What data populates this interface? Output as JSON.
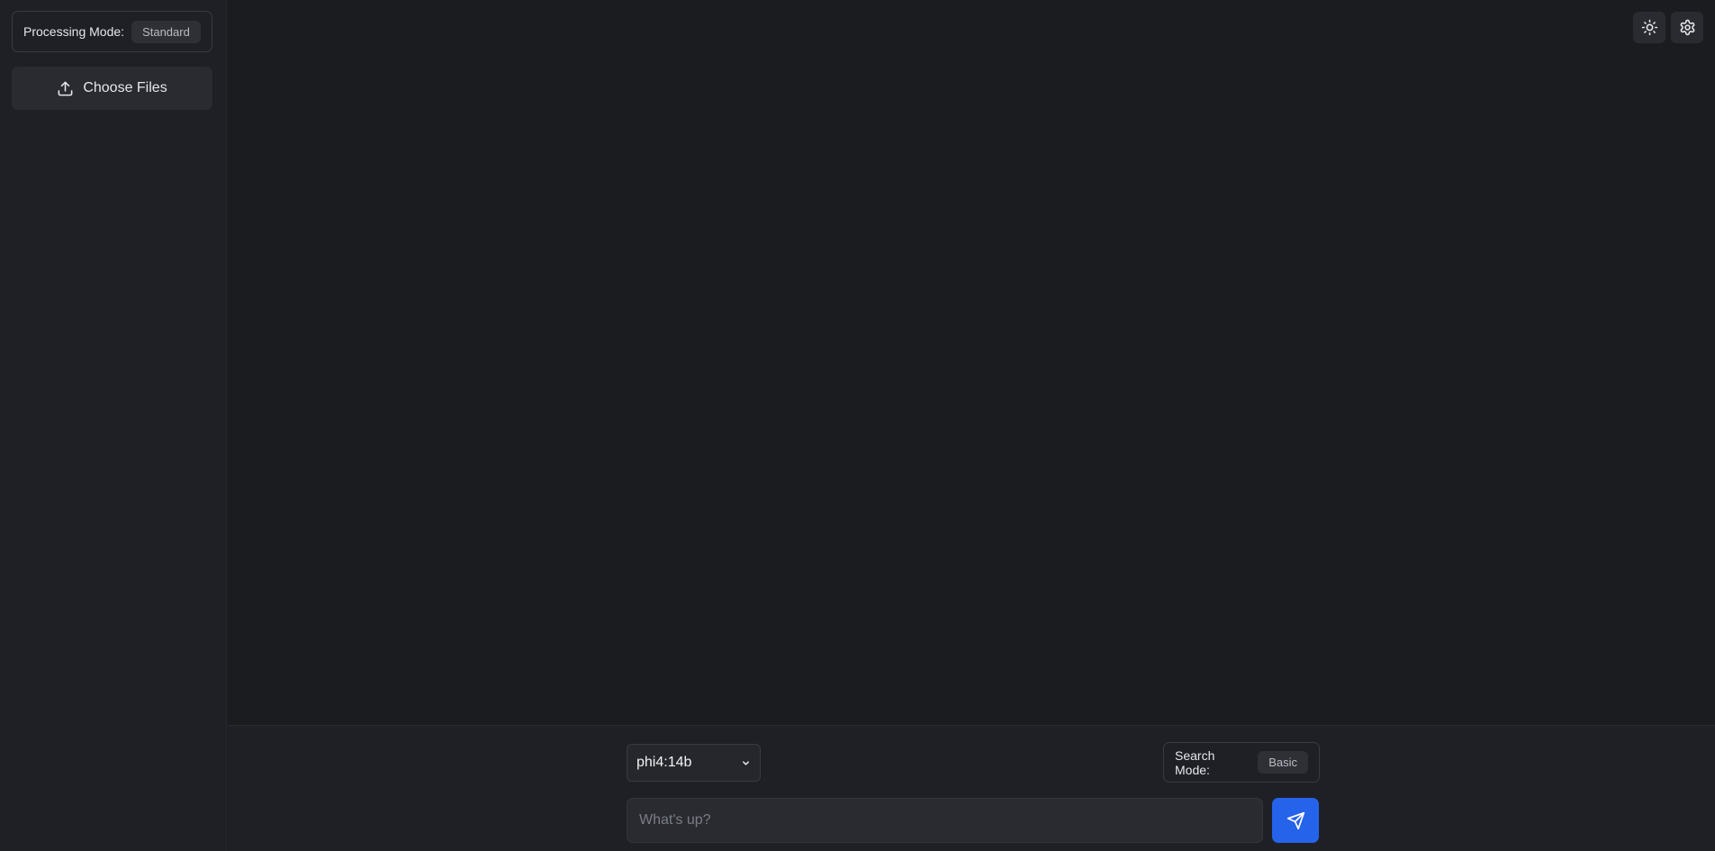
{
  "sidebar": {
    "processing_mode": {
      "label": "Processing Mode:",
      "value": "Standard"
    },
    "choose_files": {
      "label": "Choose Files",
      "icon": "upload-icon"
    }
  },
  "header": {
    "theme_toggle_icon": "sun-icon",
    "settings_icon": "gear-icon"
  },
  "composer": {
    "model": {
      "selected": "phi4:14b"
    },
    "search_mode": {
      "label": "Search Mode:",
      "value": "Basic"
    },
    "input": {
      "value": "",
      "placeholder": "What's up?"
    },
    "send_icon": "send-icon"
  },
  "colors": {
    "background": "#1b1c20",
    "sidebar": "#1f2025",
    "accent": "#2563eb"
  }
}
